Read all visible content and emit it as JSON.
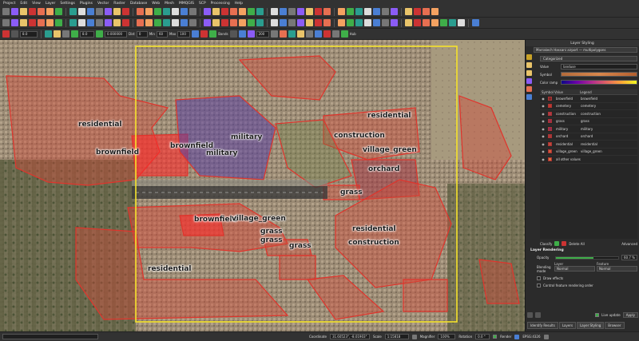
{
  "menu": [
    "Project",
    "Edit",
    "View",
    "Layer",
    "Settings",
    "Plugins",
    "Vector",
    "Raster",
    "Database",
    "Web",
    "Mesh",
    "MMQGIS",
    "SCP",
    "Processing",
    "Help"
  ],
  "toolbar3": {
    "field_a": "8.0",
    "field_b": "0.000000",
    "label_dist": "Dist",
    "field_dist": "0",
    "label_min": "Min",
    "field_min": "60",
    "label_max": "Max",
    "field_max": "100",
    "label_band": "Bands",
    "field_band": "200",
    "label_hub": "Hub"
  },
  "map_labels": [
    {
      "id": "residential-nw",
      "text": "residential"
    },
    {
      "id": "brownfield-w",
      "text": "brownfield"
    },
    {
      "id": "brownfield-c",
      "text": "brownfield"
    },
    {
      "id": "military-1",
      "text": "military"
    },
    {
      "id": "military-2",
      "text": "military"
    },
    {
      "id": "residential-ne",
      "text": "residential"
    },
    {
      "id": "construction-1",
      "text": "construction"
    },
    {
      "id": "village-green-1",
      "text": "village_green"
    },
    {
      "id": "orchard",
      "text": "orchard"
    },
    {
      "id": "grass-1",
      "text": "grass"
    },
    {
      "id": "brownfield-s",
      "text": "brownfield"
    },
    {
      "id": "village-green-2",
      "text": "village_green"
    },
    {
      "id": "residential-se",
      "text": "residential"
    },
    {
      "id": "grass-2",
      "text": "grass"
    },
    {
      "id": "grass-3",
      "text": "grass"
    },
    {
      "id": "construction-2",
      "text": "construction"
    },
    {
      "id": "grass-4",
      "text": "grass"
    },
    {
      "id": "residential-sw",
      "text": "residential"
    }
  ],
  "panel": {
    "title": "Layer Styling",
    "layer": "Marrakech Hassani airport — multipolygons",
    "renderer": "Categorized",
    "value_label": "Value",
    "value": "landuse",
    "symbol_label": "Symbol",
    "color_ramp_label": "Color ramp",
    "headers": [
      "Symbol",
      "Value",
      "Legend"
    ],
    "classes": [
      {
        "value": "brownfield",
        "legend": "brownfield",
        "color": "#7a2a2a"
      },
      {
        "value": "cemetery",
        "legend": "cemetery",
        "color": "#c0392b"
      },
      {
        "value": "construction",
        "legend": "construction",
        "color": "#b03a48"
      },
      {
        "value": "grass",
        "legend": "grass",
        "color": "#9c2f4f"
      },
      {
        "value": "military",
        "legend": "military",
        "color": "#8e2a5c"
      },
      {
        "value": "orchard",
        "legend": "orchard",
        "color": "#a83a3a"
      },
      {
        "value": "residential",
        "legend": "residential",
        "color": "#c04a3a"
      },
      {
        "value": "village_green",
        "legend": "village_green",
        "color": "#d05a3a"
      },
      {
        "value": "all other values",
        "legend": "",
        "color": "#d8703a"
      }
    ],
    "classify_label": "Classify",
    "delete_all_label": "Delete All",
    "advanced_label": "Advanced",
    "layer_rendering": "Layer Rendering",
    "opacity_label": "Opacity",
    "opacity_value": "60.7 %",
    "opacity_fraction": 0.607,
    "blending_label": "Blending mode",
    "blend_layer_label": "Layer",
    "blend_layer_value": "Normal",
    "blend_feature_label": "Feature",
    "blend_feature_value": "Normal",
    "draw_effects": "Draw effects",
    "control_order": "Control feature rendering order",
    "live_update": "Live update",
    "apply": "Apply",
    "tabs": [
      "Identify Results",
      "Layers",
      "Layer Styling",
      "Browser"
    ]
  },
  "status": {
    "coordinate_label": "Coordinate",
    "coordinate": "31.60523°, -8.01903°",
    "scale_label": "Scale",
    "scale": "1:15818",
    "magnifier_label": "Magnifier",
    "magnifier": "100%",
    "rotation_label": "Rotation",
    "rotation": "0.0 °",
    "render_label": "Render",
    "crs": "EPSG:4326"
  }
}
